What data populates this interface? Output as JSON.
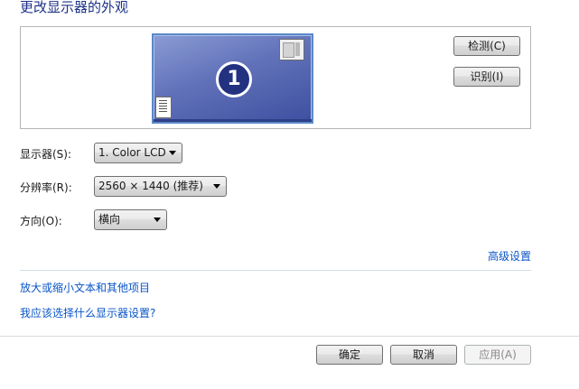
{
  "page": {
    "title": "更改显示器的外观"
  },
  "preview": {
    "monitor_number": "1",
    "detect_label": "检测(C)",
    "identify_label": "识别(I)"
  },
  "settings": {
    "display": {
      "label": "显示器(S):",
      "value": "1. Color LCD"
    },
    "resolution": {
      "label": "分辨率(R):",
      "value": "2560 × 1440 (推荐)"
    },
    "orientation": {
      "label": "方向(O):",
      "value": "横向"
    }
  },
  "links": {
    "advanced": "高级设置",
    "text_size": "放大或缩小文本和其他项目",
    "which_settings": "我应该选择什么显示器设置?"
  },
  "footer": {
    "ok_label": "确定",
    "cancel_label": "取消",
    "apply_label": "应用(A)"
  },
  "colors": {
    "title": "#1e3287",
    "link": "#0a55c8",
    "monitor": "#5a6cb6"
  }
}
